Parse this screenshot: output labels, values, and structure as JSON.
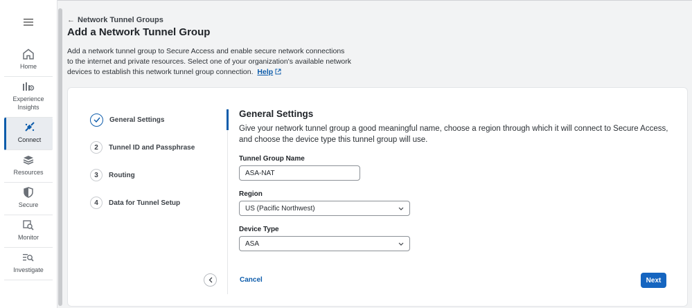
{
  "sidebar": {
    "items": [
      {
        "label": "Home",
        "icon": "home-icon"
      },
      {
        "label": "Experience Insights",
        "icon": "insights-icon"
      },
      {
        "label": "Connect",
        "icon": "connect-icon",
        "active": true
      },
      {
        "label": "Resources",
        "icon": "resources-icon"
      },
      {
        "label": "Secure",
        "icon": "shield-icon"
      },
      {
        "label": "Monitor",
        "icon": "monitor-icon"
      },
      {
        "label": "Investigate",
        "icon": "investigate-icon"
      }
    ]
  },
  "breadcrumb": {
    "back_label": "Network Tunnel Groups"
  },
  "page": {
    "title": "Add a Network Tunnel Group",
    "intro": "Add a network tunnel group to Secure Access and enable secure network connections to the internet and private resources. Select one of your organization's available network devices to establish this network tunnel group connection.",
    "help_label": "Help"
  },
  "steps": [
    {
      "num": "",
      "label": "General Settings",
      "done": true
    },
    {
      "num": "2",
      "label": "Tunnel ID and Passphrase"
    },
    {
      "num": "3",
      "label": "Routing"
    },
    {
      "num": "4",
      "label": "Data for Tunnel Setup"
    }
  ],
  "form": {
    "title": "General Settings",
    "description": "Give your network tunnel group a good meaningful name, choose a region through which it will connect to Secure Access, and choose the device type this tunnel group will use.",
    "name_label": "Tunnel Group Name",
    "name_value": "ASA-NAT",
    "region_label": "Region",
    "region_value": "US (Pacific Northwest)",
    "device_label": "Device Type",
    "device_value": "ASA"
  },
  "actions": {
    "cancel_label": "Cancel",
    "next_label": "Next"
  },
  "colors": {
    "accent": "#1565c0",
    "link": "#0d5cab"
  }
}
